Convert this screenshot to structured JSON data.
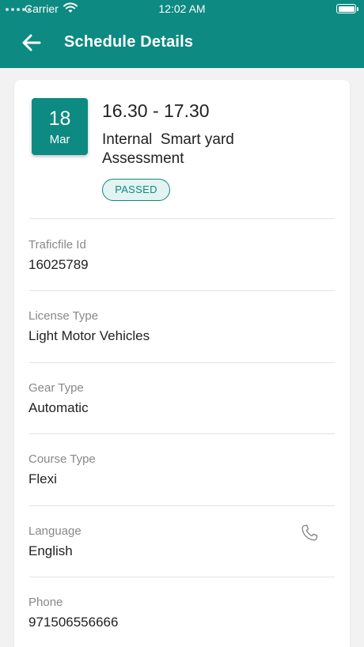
{
  "status_bar": {
    "carrier": "Carrier",
    "time": "12:02 AM"
  },
  "header": {
    "title": "Schedule Details",
    "back_icon": "arrow-left-icon"
  },
  "schedule": {
    "date_day": "18",
    "date_month": "Mar",
    "time_range": "16.30 - 17.30",
    "title_line1": "Internal  Smart yard",
    "title_line2": "Assessment",
    "status": "PASSED"
  },
  "details": [
    {
      "label": "Traficfile Id",
      "value": "16025789"
    },
    {
      "label": "License Type",
      "value": "Light Motor Vehicles"
    },
    {
      "label": "Gear Type",
      "value": "Automatic"
    },
    {
      "label": "Course Type",
      "value": "Flexi"
    },
    {
      "label": "Language",
      "value": "English"
    },
    {
      "label": "Phone",
      "value": "971506556666"
    }
  ],
  "colors": {
    "primary": "#0d8a82",
    "badge_bg": "#e3f3f1",
    "label": "#888888",
    "page_bg": "#f2f2f2"
  },
  "icons": {
    "phone": "phone-icon"
  }
}
